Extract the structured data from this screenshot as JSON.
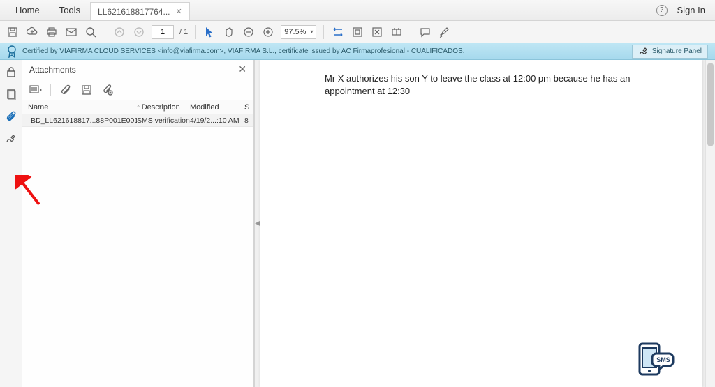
{
  "tabs": {
    "home": "Home",
    "tools": "Tools",
    "doc": "LL621618817764..."
  },
  "topbar": {
    "sign_in": "Sign In"
  },
  "toolbar": {
    "page_current": "1",
    "page_total": "/ 1",
    "zoom": "97.5%"
  },
  "signature": {
    "text": "Certified by VIAFIRMA CLOUD SERVICES <info@viafirma.com>, VIAFIRMA S.L., certificate issued by AC Firmaprofesional - CUALIFICADOS.",
    "panel_label": "Signature Panel"
  },
  "attachments": {
    "title": "Attachments",
    "cols": {
      "name": "Name",
      "desc": "Description",
      "mod": "Modified",
      "size": "S"
    },
    "rows": [
      {
        "name": "BD_LL621618817...88P001E001.xml",
        "desc": "SMS verification",
        "mod": "4/19/2...:10 AM",
        "size": "8"
      }
    ]
  },
  "document": {
    "body": "Mr X authorizes his son Y to leave the class at 12:00 pm because he has an appointment at 12:30"
  },
  "icons": {
    "sms": "SMS"
  }
}
